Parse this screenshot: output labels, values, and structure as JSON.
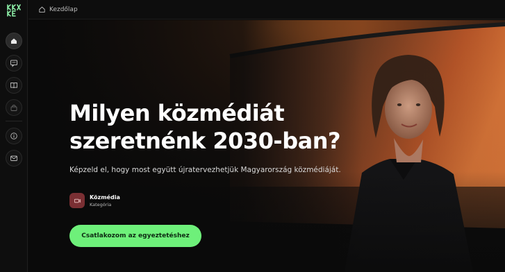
{
  "breadcrumb": {
    "label": "Kezdőlap"
  },
  "sidebar": {
    "items": [
      {
        "name": "home",
        "icon": "home-icon"
      },
      {
        "name": "messages",
        "icon": "chat-icon"
      },
      {
        "name": "book",
        "icon": "book-icon"
      },
      {
        "name": "shop",
        "icon": "bag-icon"
      },
      {
        "name": "info",
        "icon": "info-icon"
      },
      {
        "name": "mail",
        "icon": "mail-icon"
      }
    ]
  },
  "hero": {
    "headline_line1": "Milyen közmédiát",
    "headline_line2": "szeretnénk 2030-ban?",
    "subtitle": "Képzeld el, hogy most együtt újratervezhetjük Magyarország közmédiáját.",
    "category": {
      "name": "Közmédia",
      "label": "Kategória",
      "icon": "video-icon"
    },
    "cta_label": "Csatlakozom az egyeztetéshez"
  },
  "colors": {
    "accent_green": "#6ef07a",
    "category_red": "#7a2f33",
    "logo_green": "#8ef0a8"
  }
}
